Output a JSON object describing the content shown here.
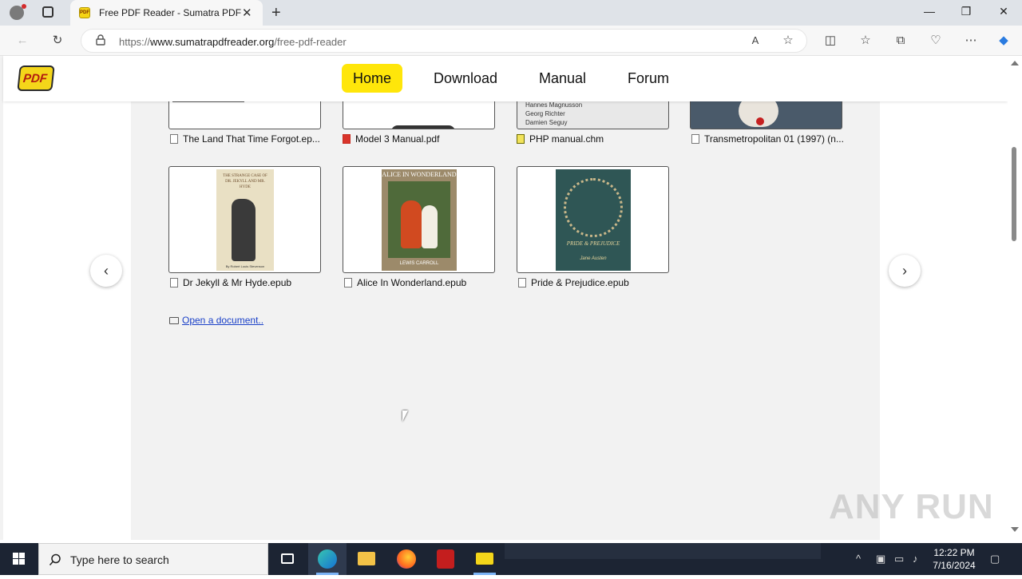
{
  "browser": {
    "tab_title": "Free PDF Reader - Sumatra PDF",
    "favicon_text": "PDF",
    "url_domain": "www.sumatrapdfreader.org",
    "url_prefix": "https://",
    "url_path": "/free-pdf-reader"
  },
  "site": {
    "logo_text": "PDF",
    "menu": [
      {
        "label": "Home",
        "active": true
      },
      {
        "label": "Download",
        "active": false
      },
      {
        "label": "Manual",
        "active": false
      },
      {
        "label": "Forum",
        "active": false
      }
    ]
  },
  "files_row1": [
    {
      "label": "The Land That Time Forgot.ep...",
      "type": "epub"
    },
    {
      "label": "Model 3 Manual.pdf",
      "type": "pdf"
    },
    {
      "label": "PHP manual.chm",
      "type": "chm",
      "thumb_lines": [
        "Hannes Magnusson",
        "Georg Richter",
        "Damien Seguy"
      ]
    },
    {
      "label": "Transmetropolitan 01 (1997) (n...",
      "type": "cbz"
    }
  ],
  "files_row2": [
    {
      "label": "Dr Jekyll & Mr Hyde.epub",
      "type": "epub",
      "cover_title": "THE STRANGE CASE OF DR. JEKYLL AND MR. HYDE",
      "cover_author": "By Robert Louis Stevenson"
    },
    {
      "label": "Alice In Wonderland.epub",
      "type": "epub",
      "cover_title": "ALICE IN WONDERLAND",
      "cover_author": "LEWIS CARROLL"
    },
    {
      "label": "Pride & Prejudice.epub",
      "type": "epub",
      "cover_title": "PRIDE & PREJUDICE",
      "cover_author": "Jane Austen"
    }
  ],
  "open_document": "Open a document..",
  "watermark": "ANY RUN",
  "taskbar": {
    "search_placeholder": "Type here to search",
    "time": "12:22 PM",
    "date": "7/16/2024"
  },
  "colors": {
    "menu_active": "#ffe60a",
    "link": "#1a40c8",
    "taskbar": "#1c2433"
  }
}
